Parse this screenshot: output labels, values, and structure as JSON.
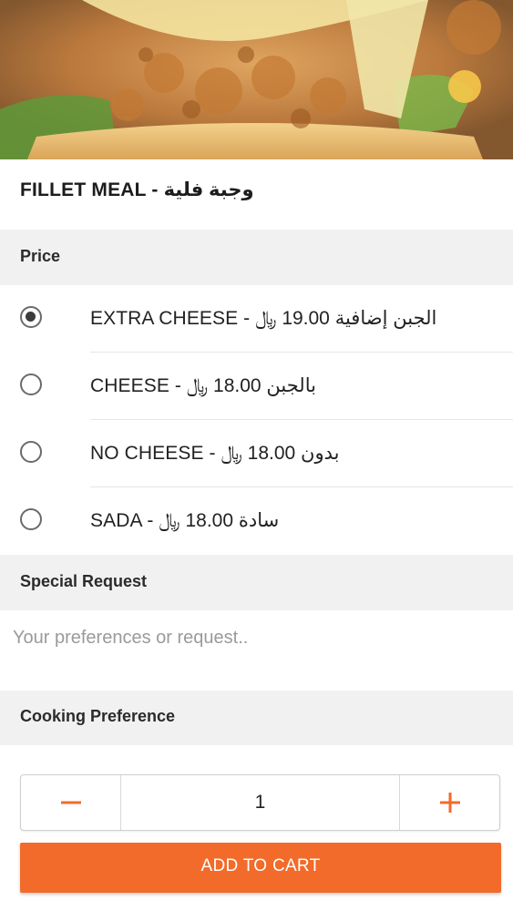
{
  "product": {
    "title": "FILLET MEAL - وجبة فلية",
    "image_icon": "fried-chicken-burger-photo"
  },
  "price_section": {
    "header": "Price",
    "options": [
      {
        "label": "EXTRA CHEESE - الجبن إضافية  19.00 ﷼",
        "selected": true
      },
      {
        "label": "CHEESE - بالجبن  18.00 ﷼",
        "selected": false
      },
      {
        "label": "NO CHEESE - بدون  18.00 ﷼",
        "selected": false
      },
      {
        "label": "SADA - سادة  18.00 ﷼",
        "selected": false
      }
    ]
  },
  "special_request": {
    "header": "Special Request",
    "placeholder": "Your preferences or request.."
  },
  "cooking_preference": {
    "header": "Cooking Preference"
  },
  "quantity": {
    "value": "1",
    "minus_icon": "minus-icon",
    "plus_icon": "plus-icon"
  },
  "cart": {
    "button_label": "ADD TO CART"
  },
  "colors": {
    "accent": "#f26b2a",
    "section_bg": "#f1f1f1",
    "radio": "#6a6a6a"
  }
}
